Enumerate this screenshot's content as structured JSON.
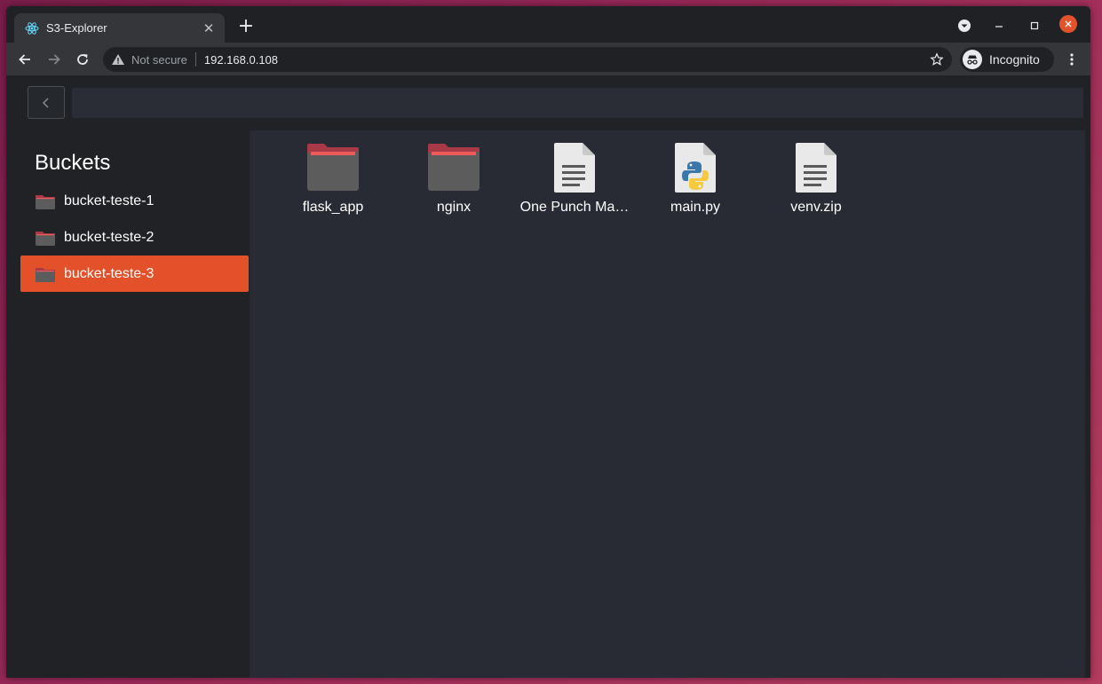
{
  "browser": {
    "tab": {
      "title": "S3-Explorer",
      "favicon": "react-icon",
      "close": "close-icon"
    },
    "new_tab": "+",
    "omnibox": {
      "security_label": "Not secure",
      "url": "192.168.0.108",
      "warning_icon": "warning-icon",
      "bookmark_icon": "star-icon"
    },
    "incognito_label": "Incognito",
    "window_close_color": "#e2532d"
  },
  "app": {
    "path_input": {
      "value": "",
      "placeholder": ""
    },
    "sidebar": {
      "title": "Buckets",
      "items": [
        {
          "label": "bucket-teste-1",
          "active": false
        },
        {
          "label": "bucket-teste-2",
          "active": false
        },
        {
          "label": "bucket-teste-3",
          "active": true
        }
      ]
    },
    "files": [
      {
        "name": "flask_app",
        "type": "folder"
      },
      {
        "name": "nginx",
        "type": "folder"
      },
      {
        "name": "One Punch Ma…",
        "type": "document"
      },
      {
        "name": "main.py",
        "type": "python"
      },
      {
        "name": "venv.zip",
        "type": "document"
      }
    ],
    "colors": {
      "accent": "#e2512a",
      "folder_tab": "#ef5b5b",
      "folder_body": "#5c5c5c"
    }
  }
}
